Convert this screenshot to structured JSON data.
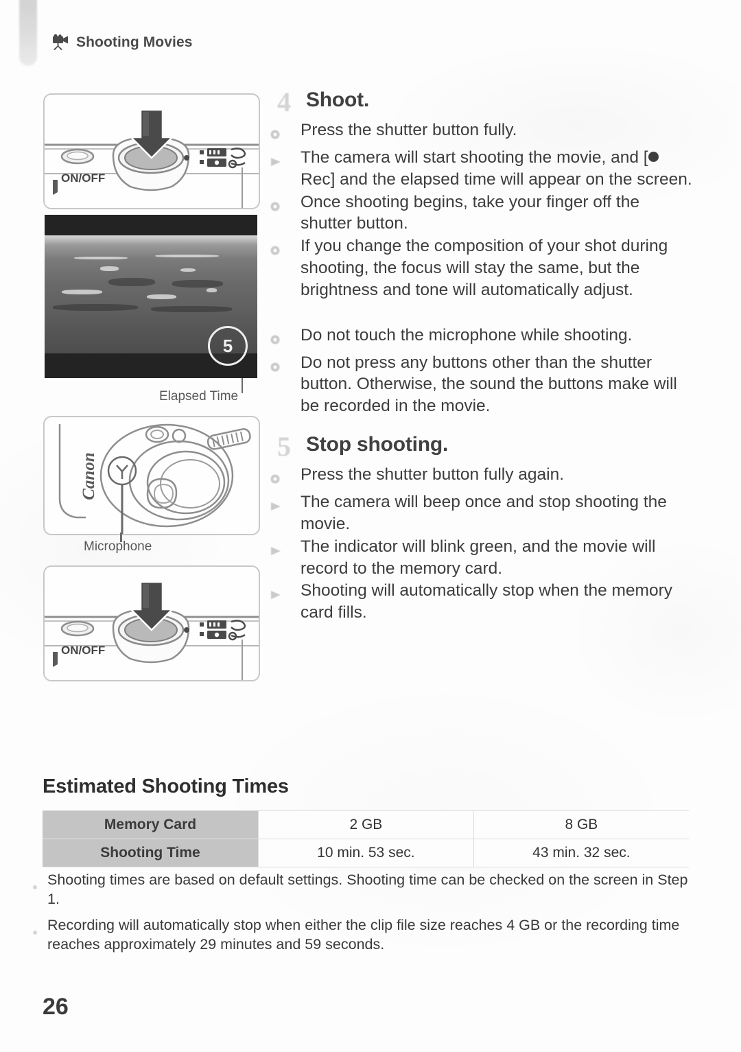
{
  "header": {
    "icon": "movie-camera-icon",
    "title": "Shooting Movies"
  },
  "figures": {
    "shutter_press_top": {
      "icon": "camera-top-view-illustration",
      "onoff_label": "ON/OFF",
      "arrow": "down-arrow-icon"
    },
    "lcd_screen": {
      "icon": "camera-lcd-screen-illustration",
      "elapsed_badge_value": "5",
      "caption": "Elapsed Time"
    },
    "camera_front": {
      "icon": "camera-front-view-illustration",
      "brand": "Canon",
      "caption": "Microphone"
    },
    "shutter_press_top_again": {
      "icon": "camera-top-view-illustration",
      "onoff_label": "ON/OFF",
      "arrow": "down-arrow-icon"
    }
  },
  "steps": [
    {
      "number": "4",
      "title": "Shoot.",
      "bullets": [
        {
          "marker": "dot-marker",
          "text": "Press the shutter button fully."
        },
        {
          "marker": "arrow-marker",
          "text_before": "The camera will start shooting the movie, and [",
          "has_rec_dot": true,
          "text_after": " Rec] and the elapsed time will appear on the screen."
        },
        {
          "marker": "dot-marker",
          "text": "Once shooting begins, take your finger off the shutter button."
        },
        {
          "marker": "dot-marker",
          "text": "If you change the composition of your shot during shooting, the focus will stay the same, but the brightness and tone will automatically adjust."
        }
      ],
      "warnings": [
        {
          "marker": "dot-marker",
          "text": "Do not touch the microphone while shooting."
        },
        {
          "marker": "dot-marker",
          "text": "Do not press any buttons other than the shutter button. Otherwise, the sound the buttons make will be recorded in the movie."
        }
      ]
    },
    {
      "number": "5",
      "title": "Stop shooting.",
      "bullets": [
        {
          "marker": "dot-marker",
          "text": "Press the shutter button fully again."
        },
        {
          "marker": "arrow-marker",
          "text": "The camera will beep once and stop shooting the movie."
        },
        {
          "marker": "arrow-marker",
          "text": "The indicator will blink green, and the movie will record to the memory card."
        },
        {
          "marker": "arrow-marker",
          "text": "Shooting will automatically stop when the memory card fills."
        }
      ]
    }
  ],
  "table": {
    "title": "Estimated Shooting Times",
    "rows": [
      {
        "header": "Memory Card",
        "values": [
          "2 GB",
          "8 GB"
        ]
      },
      {
        "header": "Shooting Time",
        "values": [
          "10 min. 53 sec.",
          "43 min. 32 sec."
        ]
      }
    ]
  },
  "notes": [
    "Shooting times are based on default settings. Shooting time can be checked on the screen in Step 1.",
    "Recording will automatically stop when either the clip file size reaches 4 GB or the recording time reaches approximately 29 minutes and 59 seconds."
  ],
  "page_number": "26",
  "colors": {
    "page_background": "#fdfdfd",
    "text": "#3a3a3a",
    "table_header_fill": "#c4c4c4",
    "figure_border": "#c8c8c8"
  }
}
